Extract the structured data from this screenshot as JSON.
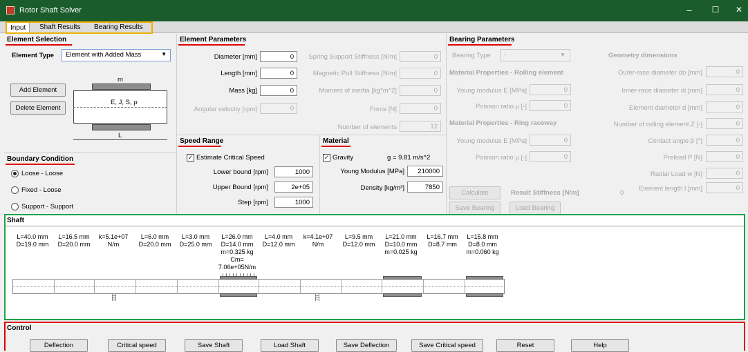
{
  "window": {
    "title": "Rotor Shaft Solver",
    "minimize": "‒",
    "maximize": "☐",
    "close": "✕"
  },
  "tabs": [
    {
      "label": "Input"
    },
    {
      "label": "Shaft Results"
    },
    {
      "label": "Bearing Results"
    }
  ],
  "element_selection": {
    "title": "Element Selection",
    "type_label": "Element Type",
    "type_value": "Element with Added Mass",
    "add_button": "Add Element",
    "delete_button": "Delete Element",
    "diagram": {
      "mass_label": "m",
      "props_label": "E, J, S, ρ",
      "length_label": "L"
    }
  },
  "boundary": {
    "title": "Boundary Condition",
    "options": [
      {
        "label": "Loose - Loose",
        "selected": true
      },
      {
        "label": "Fixed - Loose",
        "selected": false
      },
      {
        "label": "Support - Support",
        "selected": false
      }
    ]
  },
  "element_params": {
    "title": "Element Parameters",
    "diameter": {
      "label": "Diameter [mm]",
      "value": "0"
    },
    "length": {
      "label": "Length [mm]",
      "value": "0"
    },
    "mass": {
      "label": "Mass [kg]",
      "value": "0"
    },
    "angular": {
      "label": "Angular velocity [rpm]",
      "value": "0"
    },
    "spring": {
      "label": "Spring Support Stiffness [N/m]",
      "value": "0"
    },
    "magnetic": {
      "label": "Magnetic Pull Stiffness [N/m]",
      "value": "0"
    },
    "inertia": {
      "label": "Moment of inertia [kg*m^2]",
      "value": "0"
    },
    "force": {
      "label": "Force [N]",
      "value": "0"
    },
    "num_elements": {
      "label": "Number of elements",
      "value": "12"
    }
  },
  "speed_range": {
    "title": "Speed Range",
    "estimate": {
      "label": "Estimate Critical Speed",
      "checked": true
    },
    "lower": {
      "label": "Lower bound [rpm]",
      "value": "1000"
    },
    "upper": {
      "label": "Upper Bound [rpm]",
      "value": "2e+05"
    },
    "step": {
      "label": "Step [rpm]",
      "value": "1000"
    }
  },
  "material": {
    "title": "Material",
    "gravity": {
      "label": "Gravity",
      "checked": true,
      "value": "g = 9.81 m/s^2"
    },
    "young": {
      "label": "Young Modulus [MPa]",
      "value": "210000"
    },
    "density": {
      "label": "Density [kg/m³]",
      "value": "7850"
    }
  },
  "bearing": {
    "title": "Bearing Parameters",
    "type": {
      "label": "Bearing Type",
      "value": "-"
    },
    "rolling_title": "Material Properties - Rolling element",
    "rolling_young": {
      "label": "Young modulus E  [MPa]",
      "value": "0"
    },
    "rolling_poisson": {
      "label": "Poisson ratio μ  [-]",
      "value": "0"
    },
    "ring_title": "Material Properties - Ring raceway",
    "ring_young": {
      "label": "Young modulus E  [MPa]",
      "value": "0"
    },
    "ring_poisson": {
      "label": "Poisson ratio μ [-]",
      "value": "0"
    },
    "geometry_title": "Geometry dimensions",
    "outer": {
      "label": "Outer-race diameter do [mm]",
      "value": "0"
    },
    "inner": {
      "label": "Inner-race diameter di  [mm]",
      "value": "0"
    },
    "elem_d": {
      "label": "Element diameter d [mm]",
      "value": "0"
    },
    "count": {
      "label": "Number of rolling element Z [-]",
      "value": "0"
    },
    "angle": {
      "label": "Contact angle β [°]",
      "value": "0"
    },
    "preload": {
      "label": "Preload P [N]",
      "value": "0"
    },
    "radial": {
      "label": "Radial Load w [N]",
      "value": "0"
    },
    "elem_len": {
      "label": "Element length l [mm]",
      "value": "0"
    },
    "calc_button": "Calculate",
    "result_label": "Result Stiffness [N/m]",
    "result_value": "0",
    "save_button": "Save Bearing",
    "load_button": "Load Bearing"
  },
  "shaft": {
    "title": "Shaft",
    "segments": [
      {
        "label": "L=40.0 mm\nD=19.0 mm"
      },
      {
        "label": "L=16.5 mm\nD=20.0 mm"
      },
      {
        "label": "k=5.1e+07\nN/m"
      },
      {
        "label": "L=6.0 mm\nD=20.0 mm"
      },
      {
        "label": "L=3.0 mm\nD=25.0 mm"
      },
      {
        "label": "L=26.0 mm\nD=14.0 mm\nm=0.325 kg\nCm=\n7.06e+05N/m"
      },
      {
        "label": "L=4.0 mm\nD=12.0 mm"
      },
      {
        "label": "k=4.1e+07\nN/m"
      },
      {
        "label": "L=9.5 mm\nD=12.0 mm"
      },
      {
        "label": "L=21.0 mm\nD=10.0 mm\nm=0.025 kg"
      },
      {
        "label": "L=16.7 mm\nD=8.7 mm"
      },
      {
        "label": "L=15.8 mm\nD=8.0 mm\nm=0.060 kg"
      }
    ]
  },
  "control": {
    "title": "Control",
    "buttons": [
      "Deflection",
      "Critical speed",
      "Save Shaft",
      "Load Shaft",
      "Save Deflection",
      "Save Critical speed",
      "Reset",
      "Help"
    ]
  }
}
